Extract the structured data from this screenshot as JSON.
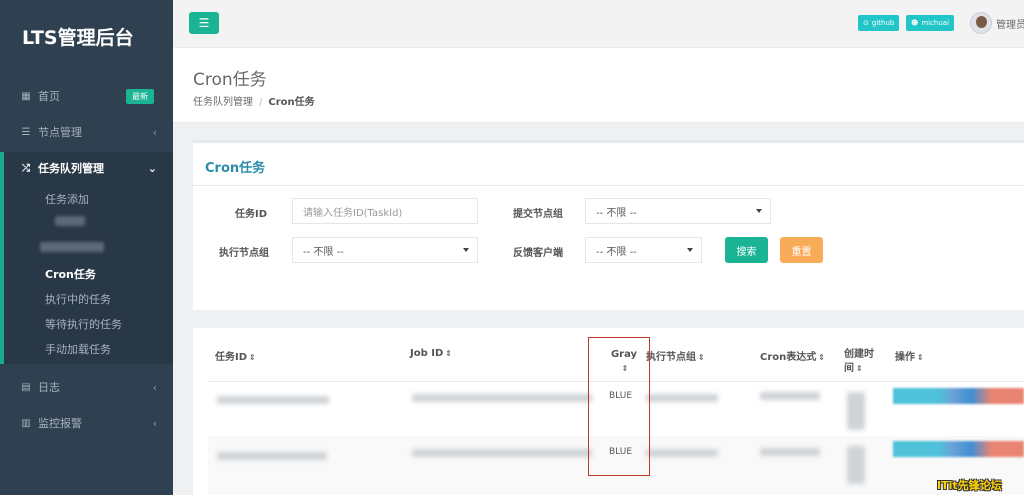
{
  "sidebar": {
    "brand": "LTS管理后台",
    "home": {
      "label": "首页",
      "badge": "最新"
    },
    "nodes": {
      "label": "节点管理"
    },
    "queue": {
      "label": "任务队列管理",
      "children": [
        "任务添加",
        "Cron任务",
        "执行中的任务",
        "等待执行的任务",
        "手动加载任务"
      ]
    },
    "logs": {
      "label": "日志"
    },
    "monitor": {
      "label": "监控报警"
    }
  },
  "topbar": {
    "github": "github",
    "user_btn": "michuai",
    "admin": "管理员"
  },
  "header": {
    "title": "Cron任务",
    "breadcrumb": [
      "任务队列管理",
      "Cron任务"
    ]
  },
  "filter": {
    "panel_title": "Cron任务",
    "task_id_label": "任务ID",
    "task_id_placeholder": "请输入任务ID(TaskId)",
    "submit_group_label": "提交节点组",
    "submit_group_value": "-- 不限 --",
    "exec_group_label": "执行节点组",
    "exec_group_value": "-- 不限 --",
    "feedback_label": "反馈客户端",
    "feedback_value": "-- 不限 --",
    "search_btn": "搜索",
    "reset_btn": "重置"
  },
  "table": {
    "headers": [
      "任务ID",
      "Job ID",
      "Gray",
      "执行节点组",
      "Cron表达式",
      "创建时间",
      "操作"
    ],
    "rows": [
      {
        "gray": "BLUE"
      },
      {
        "gray": "BLUE"
      }
    ]
  },
  "watermark": "ITit先锋论坛",
  "colors": {
    "sidebar": "#2f4050",
    "accent": "#1ab394",
    "info": "#23c6c8",
    "warning": "#f8ac59",
    "highlight": "#c0392b"
  }
}
